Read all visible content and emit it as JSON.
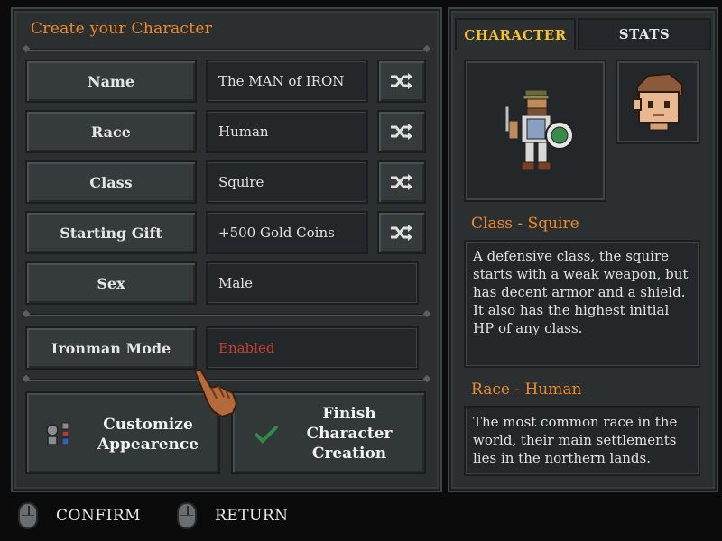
{
  "left": {
    "title": "Create your Character",
    "rows": [
      {
        "label": "Name",
        "value": "The MAN of IRON"
      },
      {
        "label": "Race",
        "value": "Human"
      },
      {
        "label": "Class",
        "value": "Squire"
      },
      {
        "label": "Starting Gift",
        "value": "+500 Gold Coins"
      },
      {
        "label": "Sex",
        "value": "Male"
      }
    ],
    "ironman": {
      "label": "Ironman Mode",
      "value": "Enabled",
      "value_color": "#d23b2b"
    },
    "customize_label": "Customize Appearence",
    "finish_label": "Finish Character Creation"
  },
  "right": {
    "tabs": [
      "CHARACTER",
      "STATS"
    ],
    "active_tab": "CHARACTER",
    "class_heading": "Class - Squire",
    "class_desc": "A defensive class, the squire starts with a weak weapon, but has decent armor and a shield. It also has the highest initial HP of any class.",
    "race_heading": "Race - Human",
    "race_desc": "The most common race in the world, their main settlements lies in the northern lands."
  },
  "footer": {
    "confirm": "CONFIRM",
    "return": "RETURN"
  },
  "icons": {
    "shuffle": "shuffle-icon",
    "check": "check-icon",
    "customize": "palette-icon",
    "cursor": "pointing-hand-cursor",
    "mouse": "mouse-icon"
  },
  "colors": {
    "accent": "#ee8a2e",
    "tab_active": "#f2c232",
    "check": "#2f8a45"
  }
}
